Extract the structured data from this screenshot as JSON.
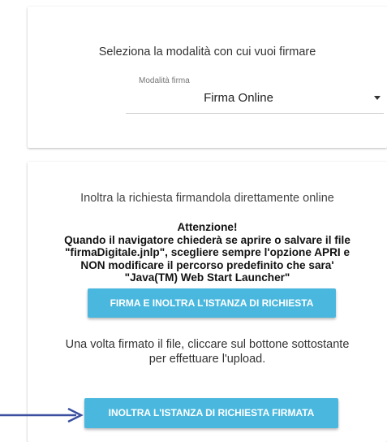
{
  "mode_card": {
    "title": "Seleziona la modalità con cui vuoi firmare",
    "select": {
      "label": "Modalità firma",
      "value": "Firma Online"
    }
  },
  "submit_card": {
    "intro": "Inoltra la richiesta firmandola direttamente online",
    "warning": {
      "heading": "Attenzione!",
      "line1": "Quando il navigatore chiederà se aprire o salvare il file",
      "line2": "\"firmaDigitale.jnlp\", scegliere sempre l'opzione APRI e",
      "line3": "NON modificare il percorso predefinito che sara'",
      "line4": "\"Java(TM) Web Start Launcher\""
    },
    "sign_button_label": "FIRMA E INOLTRA L'ISTANZA DI RICHIESTA",
    "upload_note_line1": "Una volta firmato il file, cliccare sul bottone sottostante",
    "upload_note_line2": "per effettuare l'upload.",
    "send_button_label": "INOLTRA L'ISTANZA DI RICHIESTA FIRMATA"
  },
  "colors": {
    "button": "#4ab8de",
    "arrow": "#3a4fa0"
  },
  "icons": {
    "select_caret": "caret-down-icon",
    "pointer_arrow": "arrow-right-icon"
  }
}
